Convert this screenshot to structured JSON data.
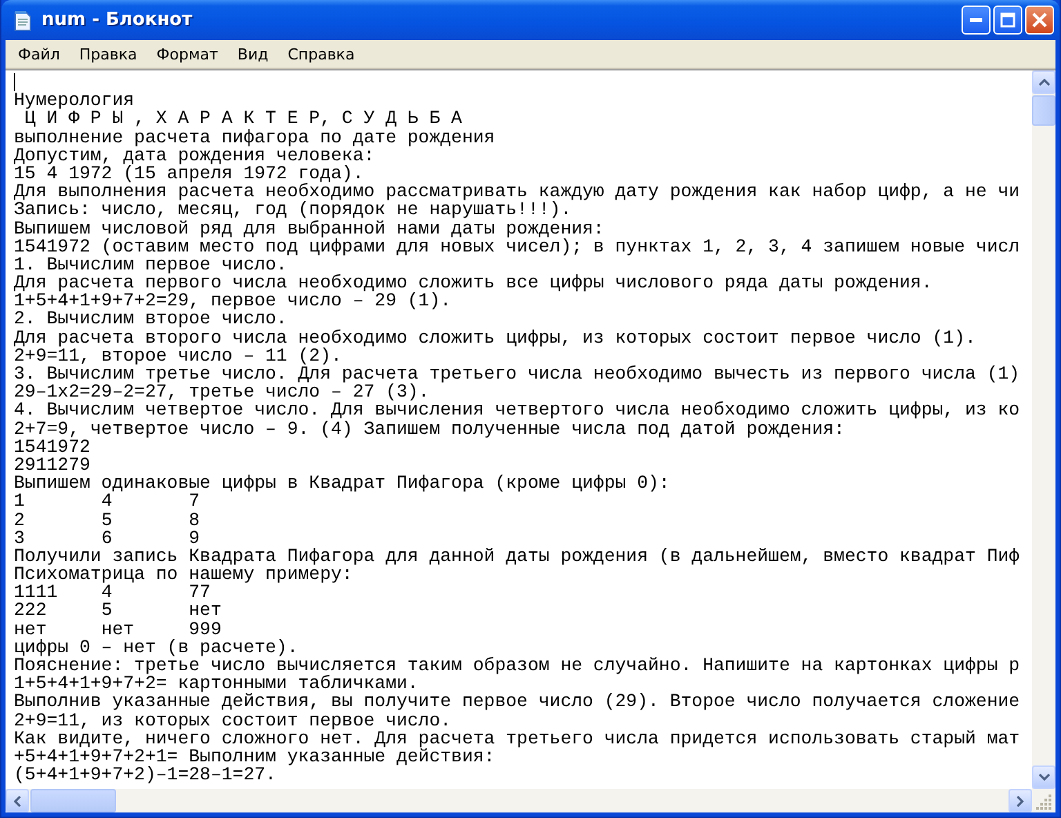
{
  "window": {
    "title": "num - Блокнот"
  },
  "menu": [
    "Файл",
    "Правка",
    "Формат",
    "Вид",
    "Справка"
  ],
  "editor": {
    "caret": true,
    "lines": [
      "Нумерология",
      " Ц И Ф Р Ы , Х А Р А К Т Е Р, С У Д Ь Б А",
      "выполнение расчета пифагора по дате рождения",
      "Допустим, дата рождения человека:",
      "15 4 1972 (15 апреля 1972 года).",
      "Для выполнения расчета необходимо рассматривать каждую дату рождения как набор цифр, а не чи",
      "Запись: число, месяц, год (порядок не нарушать!!!).",
      "Выпишем числовой ряд для выбранной нами даты рождения:",
      "1541972 (оставим место под цифрами для новых чисел); в пунктах 1, 2, 3, 4 запишем новые числ",
      "1. Вычислим первое число.",
      "Для расчета первого числа необходимо сложить все цифры числового ряда даты рождения.",
      "1+5+4+1+9+7+2=29, первое число – 29 (1).",
      "2. Вычислим второе число.",
      "Для расчета второго числа необходимо сложить цифры, из которых состоит первое число (1).",
      "2+9=11, второе число – 11 (2).",
      "3. Вычислим третье число. Для расчета третьего числа необходимо вычесть из первого числа (1)",
      "29–1х2=29–2=27, третье число – 27 (3).",
      "4. Вычислим четвертое число. Для вычисления четвертого числа необходимо сложить цифры, из ко",
      "2+7=9, четвертое число – 9. (4) Запишем полученные числа под датой рождения:",
      "1541972",
      "2911279",
      "Выпишем одинаковые цифры в Квадрат Пифагора (кроме цифры 0):",
      "1\t4\t7",
      "2\t5\t8",
      "3\t6\t9",
      "Получили запись Квадрата Пифагора для данной даты рождения (в дальнейшем, вместо квадрат Пиф",
      "Психоматрица по нашему примеру:",
      "1111\t4\t77",
      "222\t5\tнет",
      "нет\tнет\t999",
      "цифры 0 – нет (в расчете).",
      "Пояснение: третье число вычисляется таким образом не случайно. Напишите на картонках цифры р",
      "1+5+4+1+9+7+2= картонными табличками.",
      "Выполнив указанные действия, вы получите первое число (29). Второе число получается сложение",
      "2+9=11, из которых состоит первое число.",
      "Как видите, ничего сложного нет. Для расчета третьего числа придется использовать старый мат",
      "+5+4+1+9+7+2+1= Выполним указанные действия:",
      "(5+4+1+9+7+2)–1=28–1=27."
    ]
  }
}
